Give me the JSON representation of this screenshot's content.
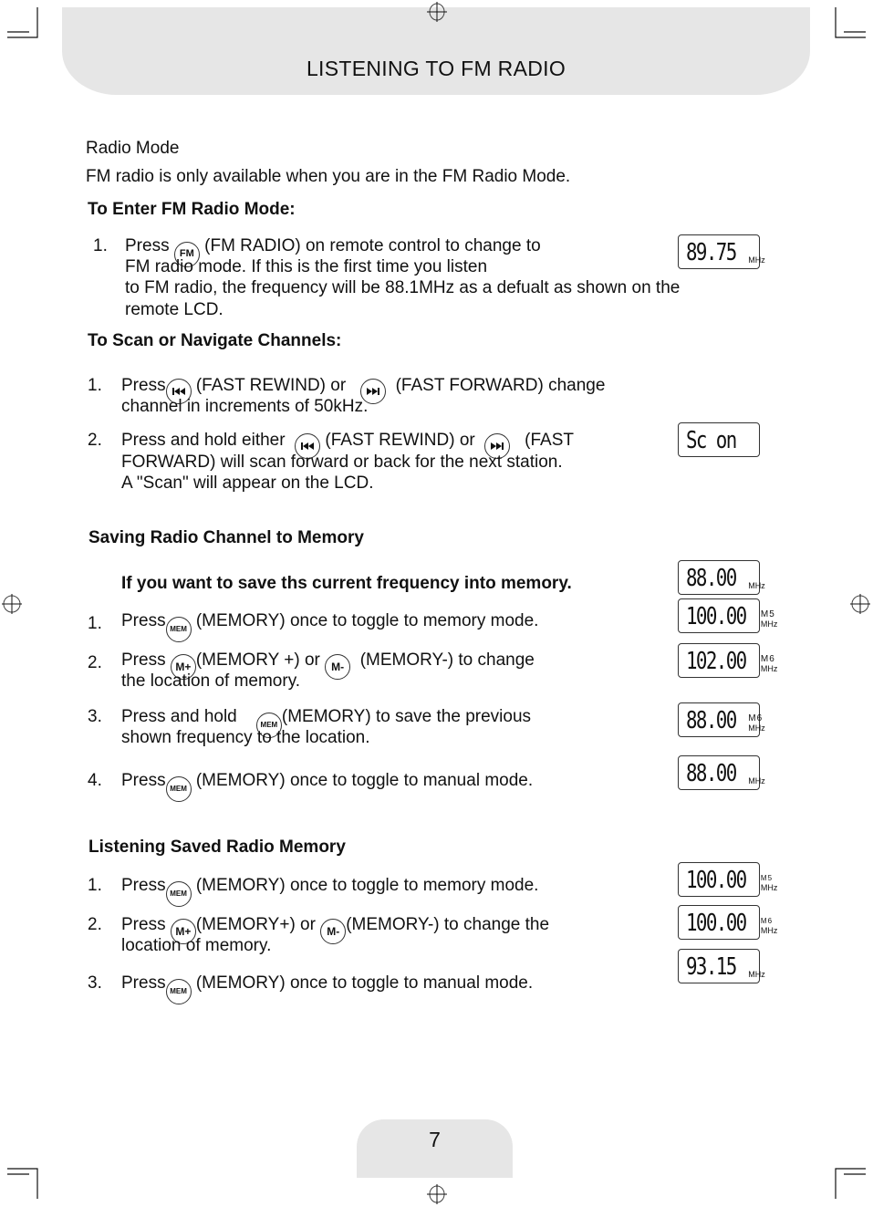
{
  "header": {
    "title": "LISTENING TO FM RADIO"
  },
  "footer": {
    "page_number": "7"
  },
  "intro": {
    "heading": "Radio Mode",
    "note": "FM radio is only available when you are in the FM Radio Mode."
  },
  "enter_mode": {
    "heading": "To Enter FM Radio Mode:",
    "step1": {
      "num": "1.",
      "before": "Press",
      "button": "FM",
      "after": "(FM RADIO) on remote control to change to",
      "line2": "FM radio mode. If this is the first time you listen",
      "line3": "to FM radio, the frequency will be 88.1MHz as a defualt as shown on the",
      "line4": "remote LCD."
    },
    "lcd": {
      "digits": "89.75",
      "unit": "MHz"
    }
  },
  "scan": {
    "heading": "To Scan or Navigate Channels:",
    "step1": {
      "num": "1.",
      "before": "Press",
      "middle": "(FAST REWIND) or",
      "after": "(FAST FORWARD) change",
      "line2": "channel in increments of 50kHz."
    },
    "step2": {
      "num": "2.",
      "before": "Press and  hold either",
      "middle": "(FAST REWIND) or",
      "after": "(FAST",
      "line2": "FORWARD) will scan forward or back for the next station.",
      "line3": "A \"Scan\" will appear on the LCD."
    },
    "lcd": {
      "digits": "Sc on"
    }
  },
  "saving": {
    "heading": "Saving Radio Channel to Memory",
    "subheading": "If you want to save ths current frequency into memory.",
    "step1": {
      "num": "1.",
      "before": "Press",
      "button": "MEM",
      "after": "(MEMORY) once to toggle to memory mode."
    },
    "step2": {
      "num": "2.",
      "before": "Press",
      "button1": "M+",
      "middle": "(MEMORY +) or",
      "button2": "M-",
      "after": "(MEMORY-) to change",
      "line2": "the location of memory."
    },
    "step3": {
      "num": "3.",
      "before": "Press and hold",
      "button": "MEM",
      "after": "(MEMORY) to save the previous",
      "line2": "shown frequency to the location."
    },
    "step4": {
      "num": "4.",
      "before": "Press",
      "button": "MEM",
      "after": "(MEMORY) once to toggle to manual mode."
    },
    "lcds": [
      {
        "digits": "88.00",
        "mem": "",
        "unit": "MHz"
      },
      {
        "digits": "100.00",
        "mem": "M5",
        "unit": "MHz"
      },
      {
        "digits": "102.00",
        "mem": "M6",
        "unit": "MHz"
      },
      {
        "digits": "88.00",
        "mem": "M6",
        "unit": "MHz"
      },
      {
        "digits": "88.00",
        "mem": "",
        "unit": "MHz"
      }
    ]
  },
  "listening": {
    "heading": "Listening Saved Radio Memory",
    "step1": {
      "num": "1.",
      "before": "Press",
      "button": "MEM",
      "after": "(MEMORY) once to toggle to memory mode."
    },
    "step2": {
      "num": "2.",
      "before": "Press",
      "button1": "M+",
      "middle": "(MEMORY+) or",
      "button2": "M-",
      "after": "(MEMORY-)  to change the",
      "line2": "location of memory."
    },
    "step3": {
      "num": "3.",
      "before": "Press",
      "button": "MEM",
      "after": "(MEMORY) once to toggle to manual mode."
    },
    "lcds": [
      {
        "digits": "100.00",
        "mem": "M5",
        "unit": "MHz"
      },
      {
        "digits": "100.00",
        "mem": "M6",
        "unit": "MHz"
      },
      {
        "digits": "93.15",
        "mem": "",
        "unit": "MHz"
      }
    ]
  }
}
